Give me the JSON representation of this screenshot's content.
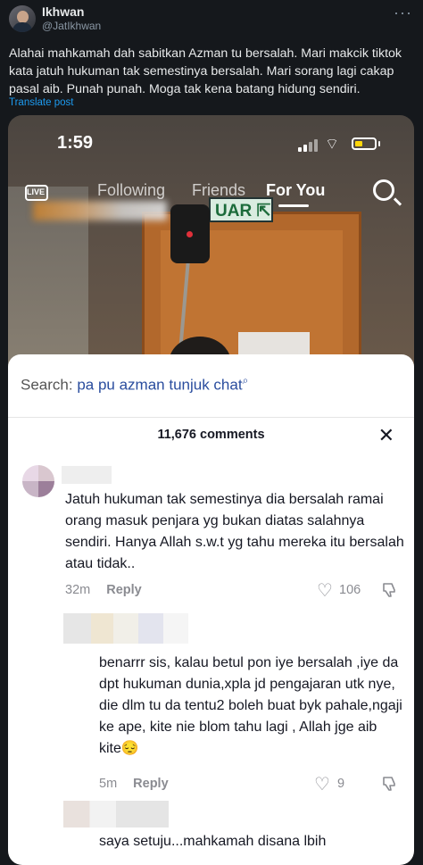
{
  "tweet": {
    "author_name": "Ikhwan",
    "author_handle": "@JatIkhwan",
    "more_icon": "more-horizontal-icon",
    "text": "Alahai mahkamah dah sabitkan Azman tu bersalah. Mari makcik tiktok kata jatuh hukuman tak semestinya bersalah. Mari sorang lagi cakap pasal aib. Punah punah. Moga tak kena batang hidung sendiri.",
    "translate_label": "Translate post"
  },
  "phone": {
    "time": "1:59",
    "nav_live": "LIVE",
    "nav_tabs": [
      "Following",
      "Friends",
      "For You"
    ],
    "active_tab": "For You",
    "exit_sign": "UAR",
    "search_label": "Search:",
    "search_query": "pa pu azman tunjuk chat",
    "comments_count": "11,676 comments",
    "comments": [
      {
        "text": "Jatuh hukuman tak semestinya dia bersalah ramai orang masuk penjara yg bukan diatas salahnya sendiri. Hanya Allah s.w.t yg tahu mereka itu bersalah atau tidak..",
        "time": "32m",
        "reply": "Reply",
        "likes": "106"
      },
      {
        "text": "benarrr sis, kalau betul pon iye bersalah ,iye da dpt hukuman dunia,xpla jd pengajaran utk nye, die dlm tu da tentu2 boleh buat byk pahale,ngaji ke ape, kite nie blom tahu lagi , Allah jge aib kite😔",
        "time": "5m",
        "reply": "Reply",
        "likes": "9"
      },
      {
        "text": "saya setuju...mahkamah disana lbih",
        "time": "",
        "reply": "",
        "likes": ""
      }
    ]
  },
  "colors": {
    "background": "#15181c",
    "link_blue": "#1d9bf0",
    "sheet_bg": "#ffffff",
    "query_blue": "#2a4d9e",
    "meta_gray": "#8a8b91"
  }
}
